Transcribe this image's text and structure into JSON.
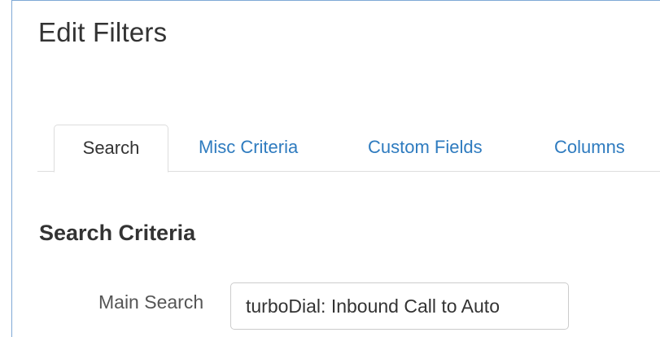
{
  "modal": {
    "title": "Edit Filters"
  },
  "tabs": [
    {
      "label": "Search",
      "active": true
    },
    {
      "label": "Misc Criteria",
      "active": false
    },
    {
      "label": "Custom Fields",
      "active": false
    },
    {
      "label": "Columns",
      "active": false
    }
  ],
  "search_criteria": {
    "heading": "Search Criteria",
    "main_search": {
      "label": "Main Search",
      "value": "turboDial: Inbound Call to Auto"
    }
  },
  "colors": {
    "link": "#2e7bbf",
    "text": "#333333",
    "panel_border": "#7fa9d6",
    "tab_border": "#dddddd"
  }
}
